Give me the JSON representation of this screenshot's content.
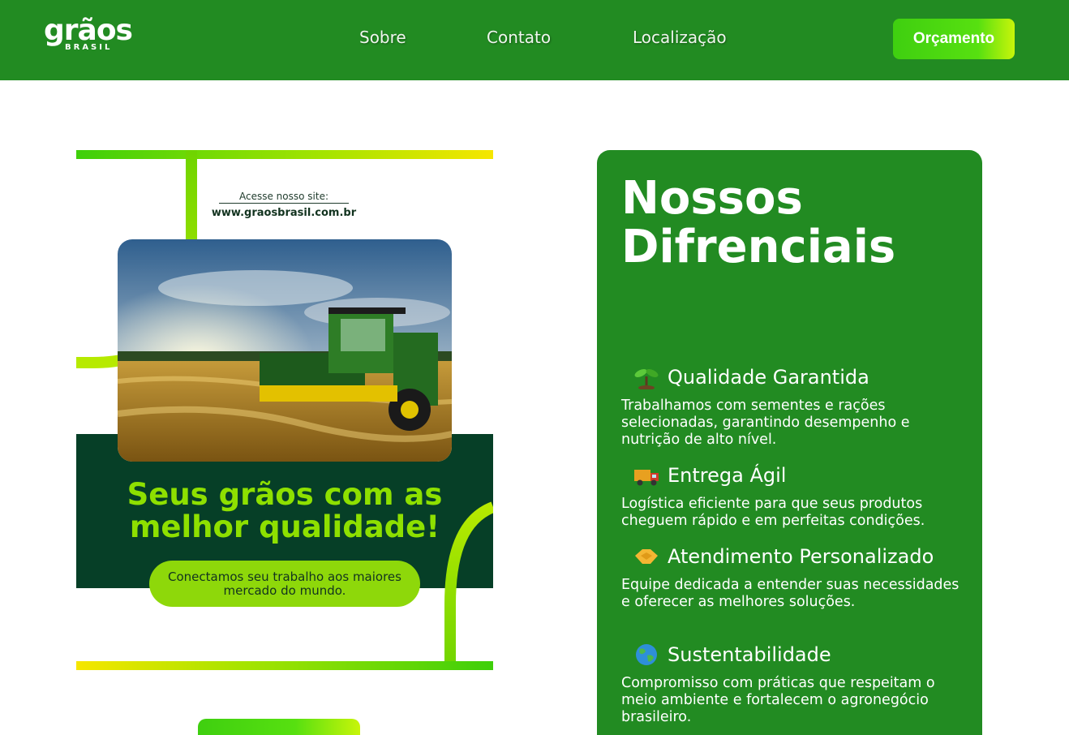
{
  "header": {
    "logo_word": "grãos",
    "logo_sub": "BRASIL",
    "nav": [
      "Sobre",
      "Contato",
      "Localização"
    ],
    "cta_label": "Orçamento"
  },
  "poster": {
    "site_label": "Acesse nosso site:",
    "site_url": "www.graosbrasil.com.br",
    "headline": "Seus grãos com as melhor qualidade!",
    "pill_text": "Conectamos seu trabalho aos maiores mercado do mundo."
  },
  "card": {
    "title": "Nossos Difrenciais",
    "features": [
      {
        "icon": "seedling-icon",
        "title": "Qualidade Garantida",
        "desc": "Trabalhamos com sementes e rações selecionadas, garantindo desempenho e nutrição de alto nível."
      },
      {
        "icon": "truck-icon",
        "title": "Entrega Ágil",
        "desc": "Logística eficiente para que seus produtos cheguem rápido e em perfeitas condições."
      },
      {
        "icon": "handshake-icon",
        "title": "Atendimento Personalizado",
        "desc": "Equipe dedicada a entender suas necessidades e oferecer as melhores soluções."
      },
      {
        "icon": "globe-icon",
        "title": "Sustentabilidade",
        "desc": "Compromisso com práticas que respeitam o meio ambiente e fortalecem o agronegócio brasileiro."
      }
    ]
  },
  "colors": {
    "brand_green": "#228b22",
    "accent_lime": "#8ee000",
    "dark_green": "#063f27"
  }
}
